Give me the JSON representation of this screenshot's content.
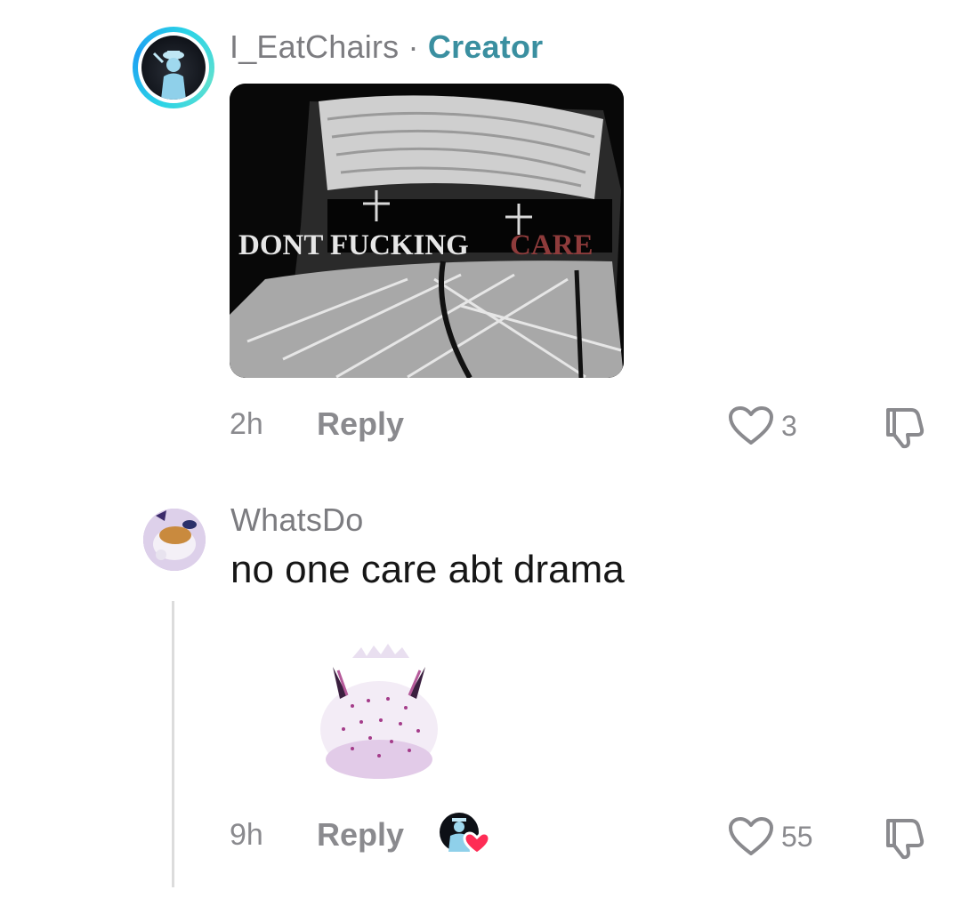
{
  "comments": [
    {
      "username": "I_EatChairs",
      "separator": "·",
      "badge": "Creator",
      "image_text_white": "DONT FUCKING ",
      "image_text_red": "CARE",
      "time": "2h",
      "reply_label": "Reply",
      "likes": "3",
      "avatar_icon": "creator-avatar",
      "like_icon": "heart-outline-icon",
      "dislike_icon": "thumbs-down-icon"
    },
    {
      "username": "WhatsDo",
      "text": "no one care abt drama",
      "time": "9h",
      "reply_label": "Reply",
      "likes": "55",
      "avatar_icon": "user-avatar",
      "liked_by_creator_icon": "creator-liked-badge",
      "like_icon": "heart-outline-icon",
      "dislike_icon": "thumbs-down-icon"
    }
  ],
  "colors": {
    "creator_badge": "#3a8fa0",
    "muted_text": "#8a8a8e",
    "heart_red": "#fe2c55"
  }
}
